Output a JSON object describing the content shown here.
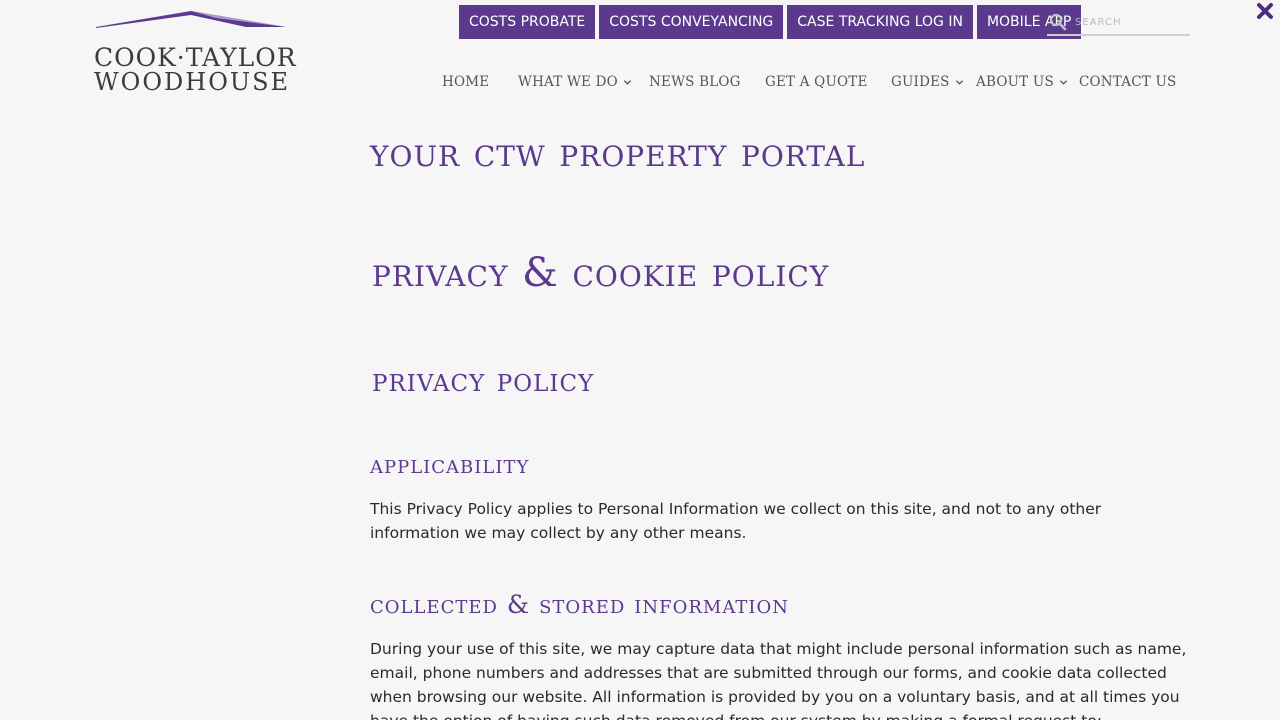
{
  "logo": {
    "line1": "COOK·TAYLOR",
    "line2": "WOODHOUSE"
  },
  "top_buttons": [
    {
      "label": "COSTS PROBATE"
    },
    {
      "label": "COSTS CONVEYANCING"
    },
    {
      "label": "CASE TRACKING LOG IN"
    },
    {
      "label": "MOBILE APP"
    }
  ],
  "search": {
    "placeholder": "SEARCH",
    "icon": "search-icon"
  },
  "close_icon": "close-icon",
  "nav": [
    {
      "label": "HOME",
      "has_dropdown": false
    },
    {
      "label": "WHAT WE DO",
      "has_dropdown": true
    },
    {
      "label": "NEWS BLOG",
      "has_dropdown": false
    },
    {
      "label": "GET A QUOTE",
      "has_dropdown": false
    },
    {
      "label": "GUIDES",
      "has_dropdown": true
    },
    {
      "label": "ABOUT US",
      "has_dropdown": true
    },
    {
      "label": "CONTACT US",
      "has_dropdown": false
    }
  ],
  "content": {
    "portal_title": "YOUR CTW PROPERTY PORTAL",
    "policy_title": "PRIVACY & COOKIE POLICY",
    "privacy_title": "PRIVACY POLICY",
    "applicability_title": "APPLICABILITY",
    "applicability_text": "This Privacy Policy applies to Personal Information we collect on this site, and not to any other information we may collect by any other means.",
    "collected_title": "COLLECTED & STORED INFORMATION",
    "collected_text": "During your use of this site, we may capture data that might include personal information such as name, email, phone numbers and addresses that are submitted through our forms, and cookie data collected when browsing our website. All information is provided by you on a voluntary basis, and at all times you have the option of having such data removed from our system by making a formal request to:"
  },
  "colors": {
    "brand_purple": "#5b3a8e",
    "background": "#f6f6f7"
  }
}
